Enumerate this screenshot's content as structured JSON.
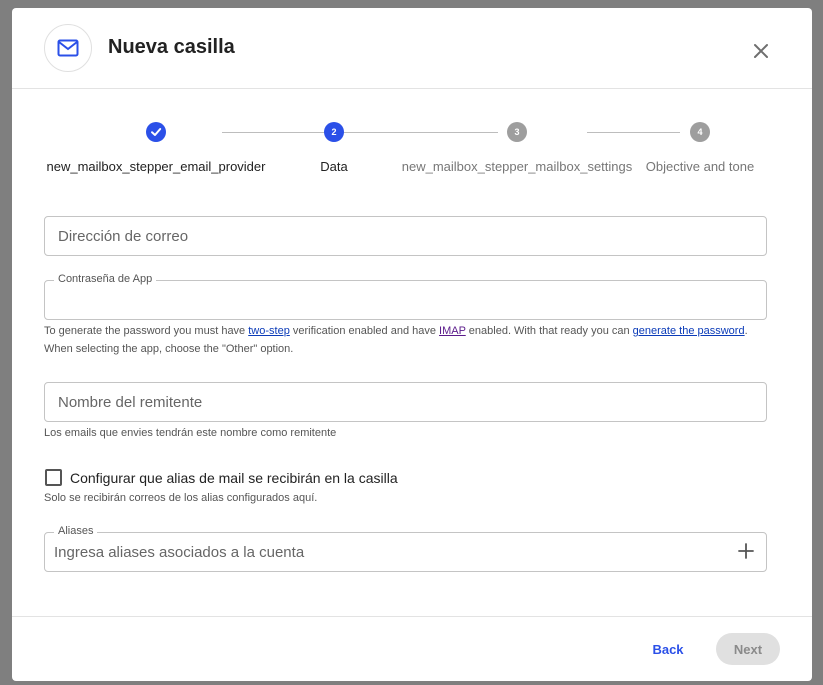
{
  "modal": {
    "title": "Nueva casilla",
    "header_icon": "mail-icon",
    "close_icon": "close-icon"
  },
  "stepper": {
    "steps": [
      {
        "number": "1",
        "label": "new_mailbox_stepper_email_provider",
        "state": "completed"
      },
      {
        "number": "2",
        "label": "Data",
        "state": "active"
      },
      {
        "number": "3",
        "label": "new_mailbox_stepper_mailbox_settings",
        "state": "pending"
      },
      {
        "number": "4",
        "label": "Objective and tone",
        "state": "pending"
      }
    ],
    "colors": {
      "active": "#2b50e8",
      "pending": "#9e9e9e",
      "line": "#bdbdbd"
    }
  },
  "form": {
    "email": {
      "placeholder": "Dirección de correo",
      "value": ""
    },
    "app_password": {
      "label": "Contraseña de App",
      "value": "",
      "help": {
        "t1": "To generate the password you must have ",
        "link1": "two-step",
        "t2": " verification enabled and have ",
        "link2": "IMAP",
        "t3": " enabled. With that ready you can ",
        "link3": "generate the password",
        "t4": ". When selecting the app, choose the \"Other\" option."
      }
    },
    "sender_name": {
      "placeholder": "Nombre del remitente",
      "value": "",
      "help": "Los emails que envies tendrán este nombre como remitente"
    },
    "aliases_checkbox": {
      "label": "Configurar que alias de mail se recibirán en la casilla",
      "checked": false,
      "help": "Solo se recibirán correos de los alias configurados aquí."
    },
    "aliases": {
      "label": "Aliases",
      "placeholder": "Ingresa aliases asociados a la cuenta",
      "value": "",
      "add_icon": "plus-icon"
    }
  },
  "footer": {
    "back_label": "Back",
    "next_label": "Next",
    "next_disabled": true
  }
}
